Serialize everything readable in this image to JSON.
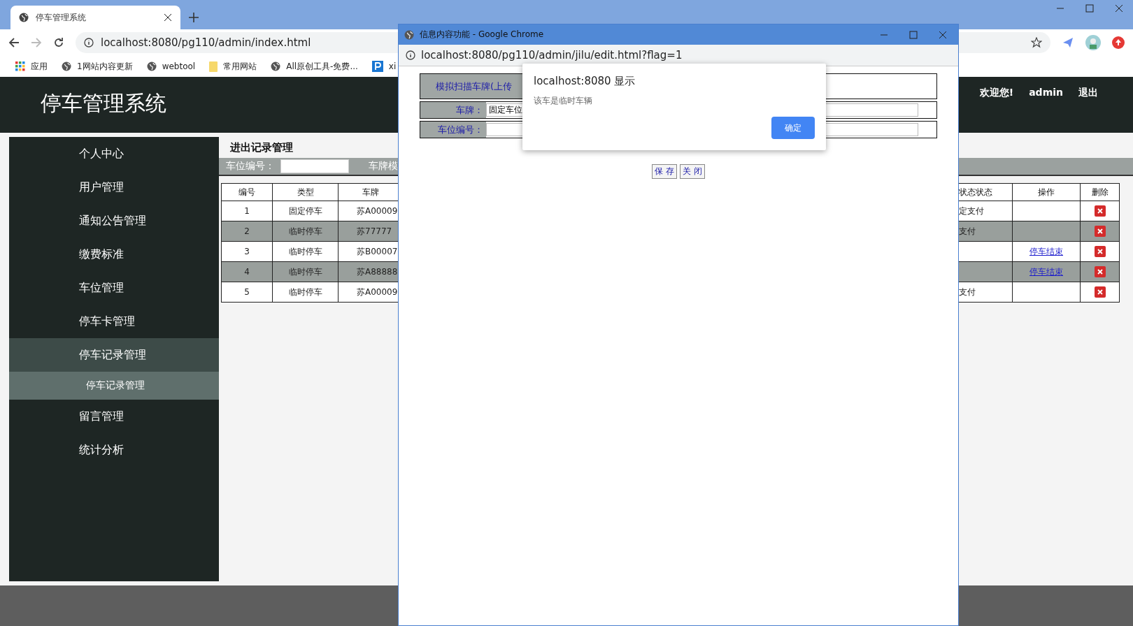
{
  "browser": {
    "tab_title": "停车管理系统",
    "address": "localhost:8080/pg110/admin/index.html",
    "bookmarks": [
      {
        "kind": "apps",
        "label": "应用"
      },
      {
        "kind": "globe",
        "label": "1网站内容更新"
      },
      {
        "kind": "globe",
        "label": "webtool"
      },
      {
        "kind": "folder",
        "label": "常用网站"
      },
      {
        "kind": "globe",
        "label": "All原创工具-免费..."
      },
      {
        "kind": "p",
        "label": "xi"
      }
    ]
  },
  "header": {
    "title": "停车管理系统",
    "welcome": "欢迎您!",
    "user": "admin",
    "logout": "退出"
  },
  "sidebar": {
    "items": [
      {
        "label": "个人中心",
        "selected": false
      },
      {
        "label": "用户管理",
        "selected": false
      },
      {
        "label": "通知公告管理",
        "selected": false
      },
      {
        "label": "缴费标准",
        "selected": false
      },
      {
        "label": "车位管理",
        "selected": false
      },
      {
        "label": "停车卡管理",
        "selected": false
      },
      {
        "label": "停车记录管理",
        "selected": true,
        "children": [
          {
            "label": "停车记录管理",
            "selected": true
          }
        ]
      },
      {
        "label": "留言管理",
        "selected": false
      },
      {
        "label": "统计分析",
        "selected": false
      }
    ]
  },
  "content": {
    "title": "进出记录管理",
    "filter": {
      "label": "车位编号：",
      "second_label": "车牌模"
    },
    "table": {
      "columns": [
        "编号",
        "类型",
        "车牌",
        "状态状态",
        "操作",
        "删除"
      ],
      "rows": [
        {
          "id": "1",
          "type": "固定停车",
          "plate": "苏A00009",
          "status": "定支付"
        },
        {
          "id": "2",
          "type": "临时停车",
          "plate": "苏77777",
          "status": "支付"
        },
        {
          "id": "3",
          "type": "临时停车",
          "plate": "苏B00007",
          "action": "停车结束"
        },
        {
          "id": "4",
          "type": "临时停车",
          "plate": "苏A88888",
          "action": "停车结束"
        },
        {
          "id": "5",
          "type": "临时停车",
          "plate": "苏A00009",
          "status": "支付"
        }
      ]
    }
  },
  "popup": {
    "window_title": "信息内容功能 - Google Chrome",
    "address": "localhost:8080/pg110/admin/jilu/edit.html?flag=1",
    "form": [
      {
        "kind": "banner",
        "label": "模拟扫描车牌(上传"
      },
      {
        "kind": "field",
        "label": "车牌：",
        "value": "固定车位"
      },
      {
        "kind": "field",
        "label": "车位编号："
      }
    ],
    "buttons": [
      "保 存",
      "关 闭"
    ],
    "alert": {
      "title": "localhost:8080 显示",
      "message": "该车是临时车辆",
      "button": "确定"
    }
  }
}
